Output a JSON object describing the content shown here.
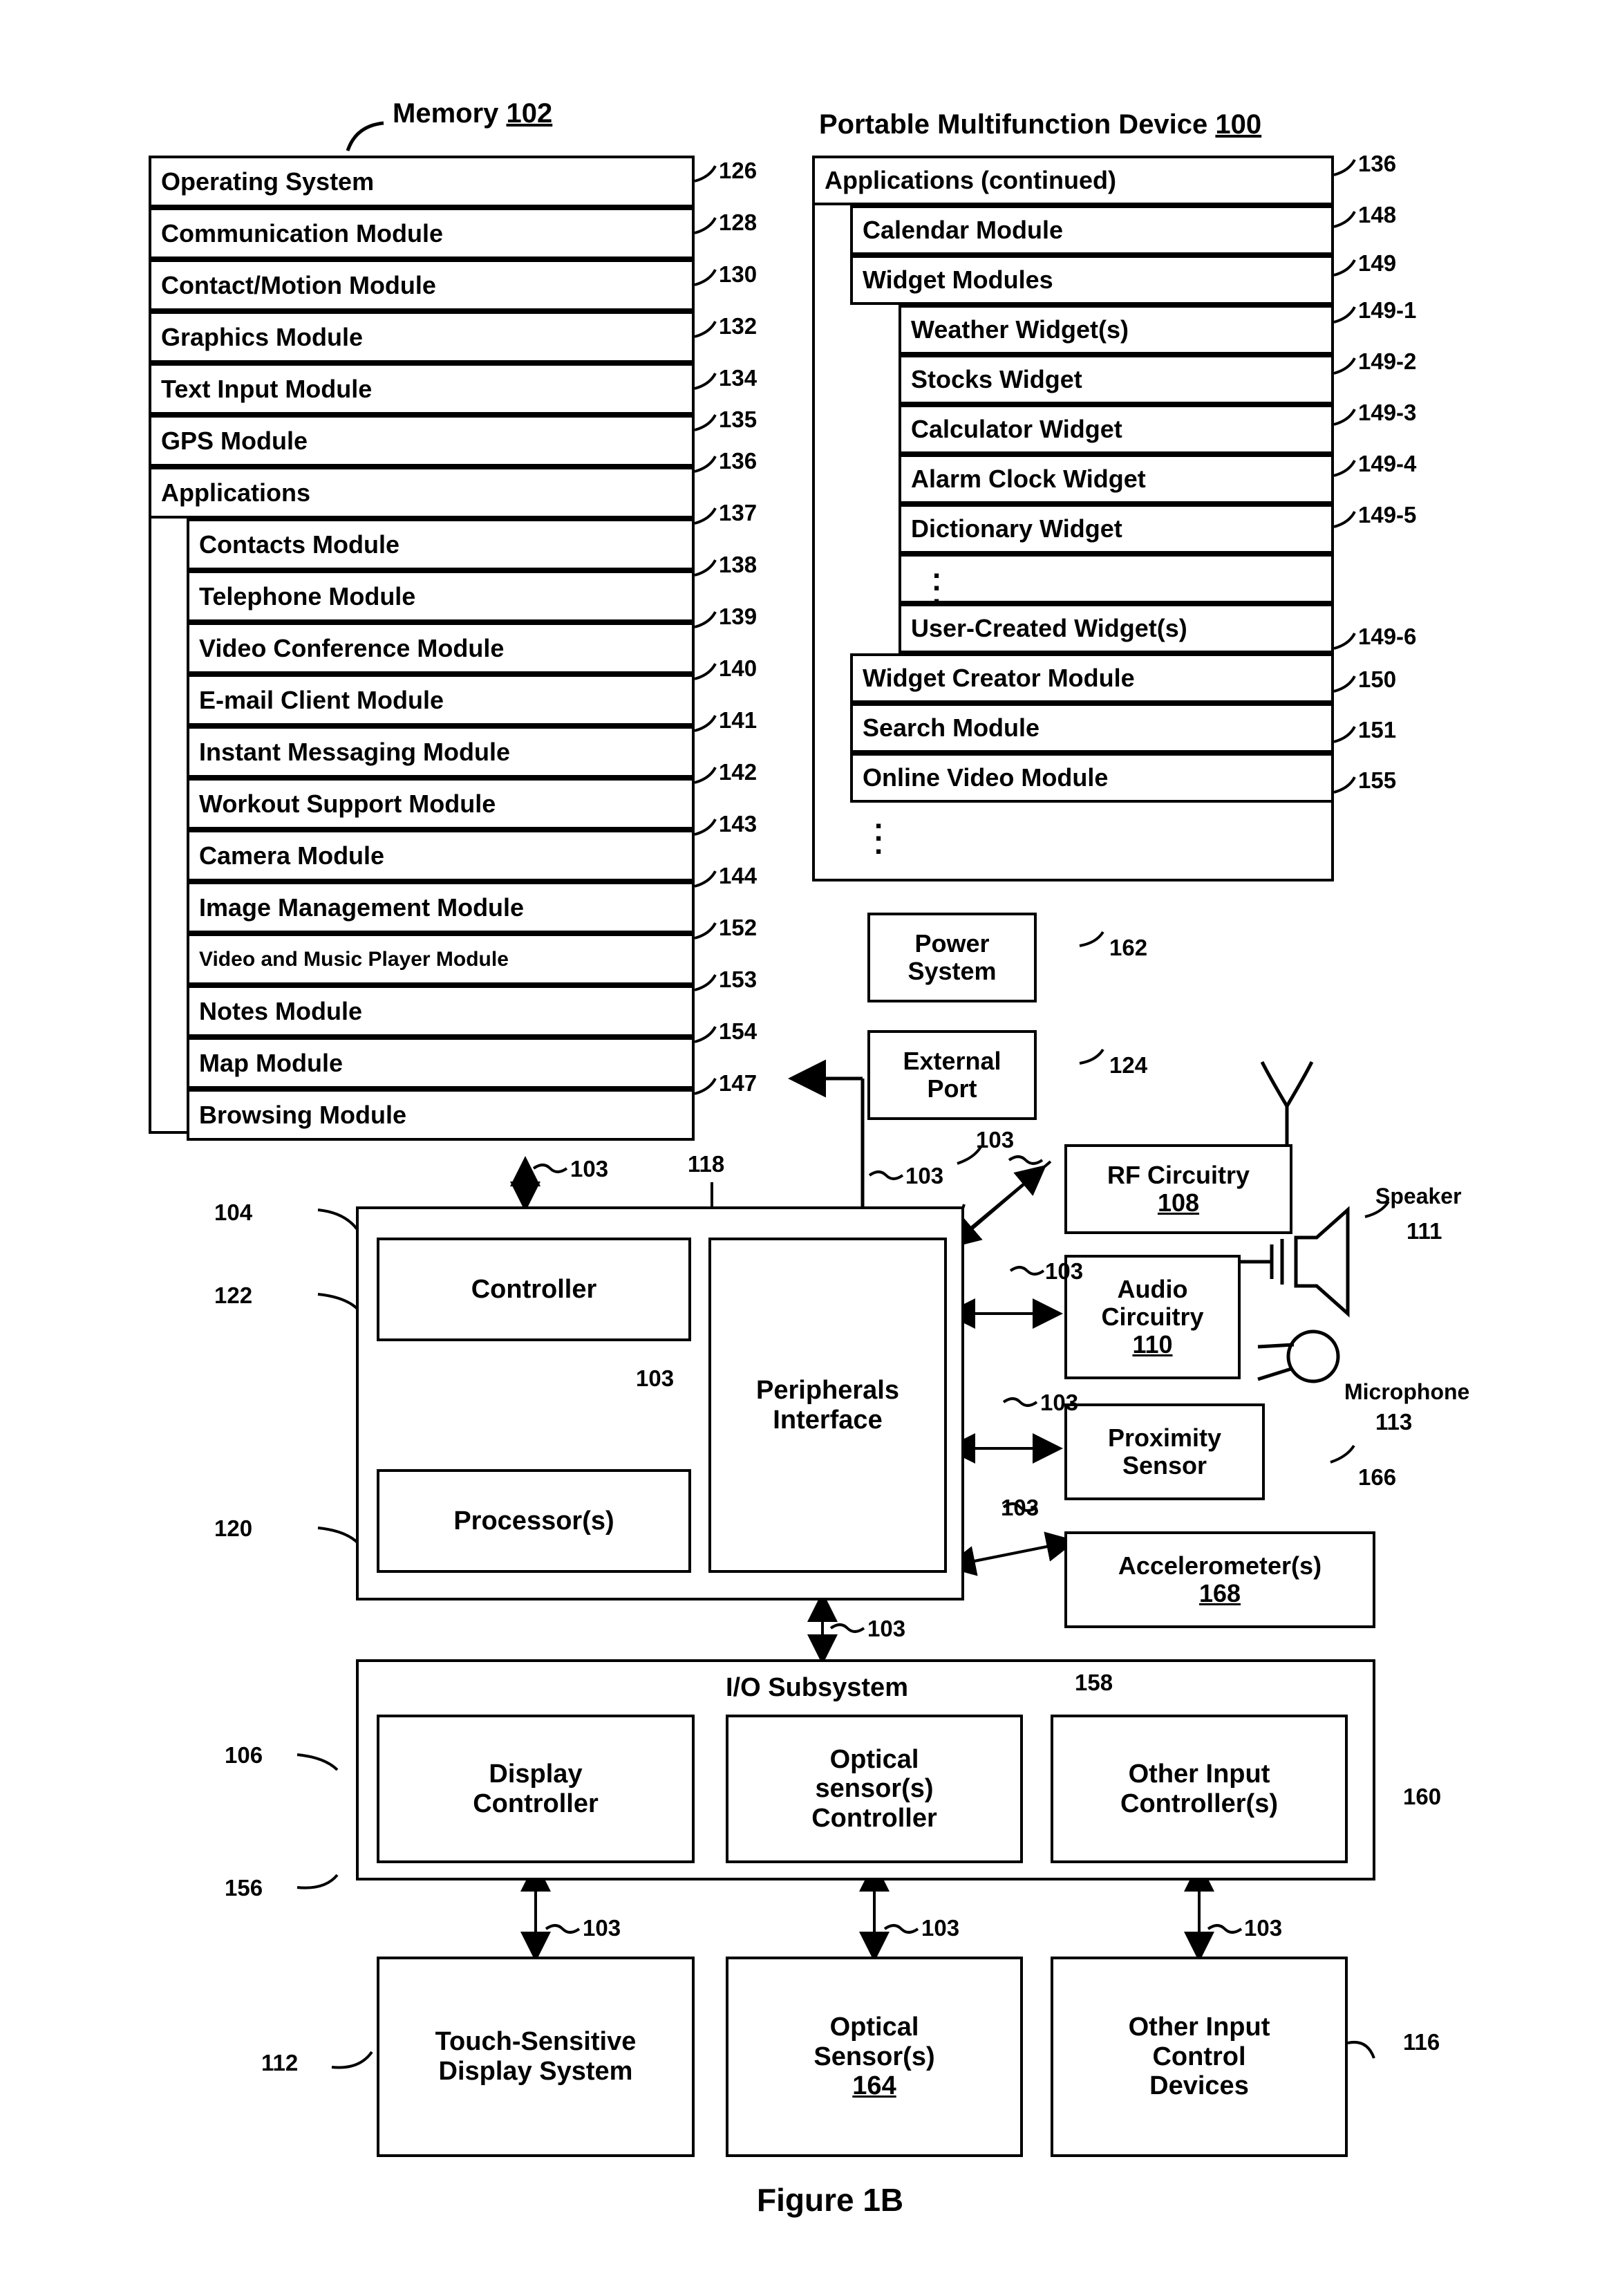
{
  "figure": {
    "caption": "Figure 1B"
  },
  "memory": {
    "title": "Memory",
    "title_ref": "102",
    "rows": [
      {
        "label": "Operating System",
        "ref": "126",
        "indent": 0
      },
      {
        "label": "Communication Module",
        "ref": "128",
        "indent": 0
      },
      {
        "label": "Contact/Motion Module",
        "ref": "130",
        "indent": 0
      },
      {
        "label": "Graphics Module",
        "ref": "132",
        "indent": 0
      },
      {
        "label": "Text Input Module",
        "ref": "134",
        "indent": 0
      },
      {
        "label": "GPS Module",
        "ref": "135",
        "indent": 0
      },
      {
        "label": "Applications",
        "ref": "136",
        "indent": 0
      },
      {
        "label": "Contacts Module",
        "ref": "137",
        "indent": 1
      },
      {
        "label": "Telephone Module",
        "ref": "138",
        "indent": 1
      },
      {
        "label": "Video Conference Module",
        "ref": "139",
        "indent": 1
      },
      {
        "label": "E-mail Client Module",
        "ref": "140",
        "indent": 1
      },
      {
        "label": "Instant Messaging Module",
        "ref": "141",
        "indent": 1
      },
      {
        "label": "Workout Support Module",
        "ref": "142",
        "indent": 1
      },
      {
        "label": "Camera Module",
        "ref": "143",
        "indent": 1
      },
      {
        "label": "Image Management Module",
        "ref": "144",
        "indent": 1
      },
      {
        "label": "Video and Music Player Module",
        "ref": "152",
        "indent": 1
      },
      {
        "label": "Notes Module",
        "ref": "153",
        "indent": 1
      },
      {
        "label": "Map Module",
        "ref": "154",
        "indent": 1
      },
      {
        "label": "Browsing Module",
        "ref": "147",
        "indent": 1
      }
    ]
  },
  "device": {
    "title": "Portable Multifunction Device",
    "title_ref": "100",
    "rows": [
      {
        "label": "Applications (continued)",
        "ref": "136",
        "indent": 0
      },
      {
        "label": "Calendar Module",
        "ref": "148",
        "indent": 1
      },
      {
        "label": "Widget Modules",
        "ref": "149",
        "indent": 1
      },
      {
        "label": "Weather Widget(s)",
        "ref": "149-1",
        "indent": 2
      },
      {
        "label": "Stocks Widget",
        "ref": "149-2",
        "indent": 2
      },
      {
        "label": "Calculator Widget",
        "ref": "149-3",
        "indent": 2
      },
      {
        "label": "Alarm Clock Widget",
        "ref": "149-4",
        "indent": 2
      },
      {
        "label": "Dictionary Widget",
        "ref": "149-5",
        "indent": 2
      },
      {
        "label": "",
        "ref": "",
        "indent": 2
      },
      {
        "label": "User-Created Widget(s)",
        "ref": "149-6",
        "indent": 2
      },
      {
        "label": "Widget Creator Module",
        "ref": "150",
        "indent": 1
      },
      {
        "label": "Search Module",
        "ref": "151",
        "indent": 1
      },
      {
        "label": "Online Video Module",
        "ref": "155",
        "indent": 1
      }
    ]
  },
  "blocks": {
    "power_system": {
      "label": "Power\nSystem",
      "ref": "162"
    },
    "external_port": {
      "label": "External\nPort",
      "ref": "124"
    },
    "rf_circuitry": {
      "label": "RF Circuitry",
      "ref": "108"
    },
    "audio_circuitry": {
      "label": "Audio\nCircuitry",
      "ref": "110"
    },
    "proximity_sensor": {
      "label": "Proximity\nSensor",
      "ref": "166"
    },
    "accelerometer": {
      "label": "Accelerometer(s)",
      "ref": "168"
    },
    "controller": {
      "label": "Controller",
      "ref": "122"
    },
    "processor": {
      "label": "Processor(s)",
      "ref": "120"
    },
    "peripherals_interface": {
      "label": "Peripherals\nInterface",
      "ref": "118"
    },
    "cpu_group_ref": "104",
    "io_subsystem": {
      "label": "I/O Subsystem",
      "ref": "156"
    },
    "display_controller": {
      "label": "Display\nController",
      "ref": "106"
    },
    "optical_sensor_controller": {
      "label": "Optical\nsensor(s)\nController",
      "ref": "158"
    },
    "other_input_controller": {
      "label": "Other Input\nController(s)",
      "ref": "160"
    },
    "touch_display": {
      "label": "Touch-Sensitive\nDisplay System",
      "ref": "112"
    },
    "optical_sensor": {
      "label": "Optical\nSensor(s)",
      "ref": "164"
    },
    "other_input_devices": {
      "label": "Other Input\nControl\nDevices",
      "ref": "116"
    },
    "speaker": {
      "label": "Speaker",
      "ref": "111"
    },
    "microphone": {
      "label": "Microphone",
      "ref": "113"
    }
  },
  "bus_label": "103"
}
